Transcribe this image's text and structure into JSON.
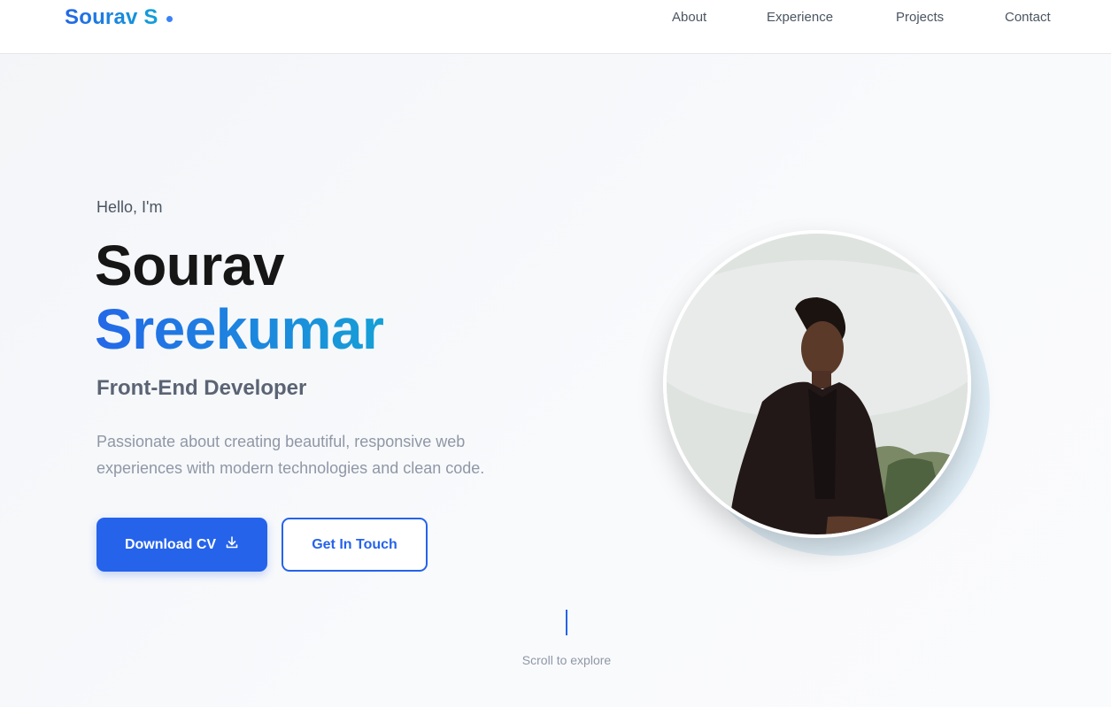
{
  "nav": {
    "brand": "Sourav S",
    "links": [
      "About",
      "Experience",
      "Projects",
      "Contact"
    ]
  },
  "hero": {
    "greeting": "Hello, I'm",
    "first_name": "Sourav",
    "last_name": "Sreekumar",
    "role": "Front-End Developer",
    "description": "Passionate about creating beautiful, responsive web experiences with modern technologies and clean code.",
    "primary_button": "Download CV",
    "secondary_button": "Get In Touch",
    "scroll_hint": "Scroll to explore"
  },
  "colors": {
    "accent": "#2563eb",
    "gradient_end": "#11a0d8",
    "text_dark": "#161616",
    "text_muted": "#8f97a6"
  },
  "icons": {
    "download": "download-icon",
    "brand_dot": "brand-dot-icon"
  }
}
